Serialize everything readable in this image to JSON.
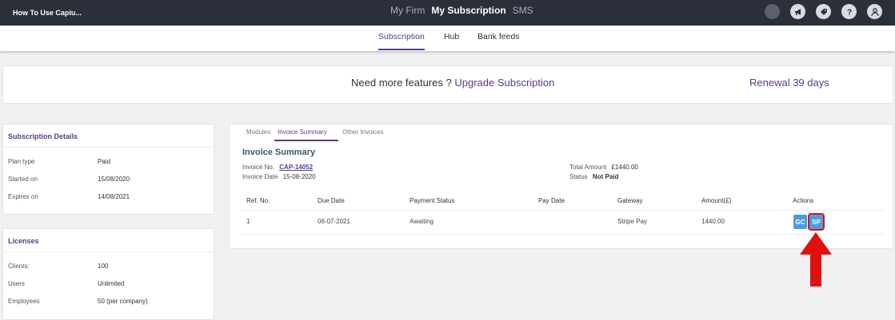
{
  "topbar": {
    "firm_name": "How To Use Capiu...",
    "nav": [
      {
        "label": "My Firm"
      },
      {
        "label": "My Subscription"
      },
      {
        "label": "SMS"
      }
    ]
  },
  "subnav": {
    "tabs": [
      {
        "label": "Subscription"
      },
      {
        "label": "Hub"
      },
      {
        "label": "Bank feeds"
      }
    ]
  },
  "banner": {
    "prompt": "Need more features ? ",
    "upgrade_link": "Upgrade Subscription",
    "renewal": "Renewal 39 days"
  },
  "subscription_details": {
    "title": "Subscription Details",
    "rows": [
      {
        "key": "Plan type",
        "value": "Paid"
      },
      {
        "key": "Started on",
        "value": "15/08/2020"
      },
      {
        "key": "Expires on",
        "value": "14/08/2021"
      }
    ]
  },
  "licenses": {
    "title": "Licenses",
    "rows": [
      {
        "key": "Clients:",
        "value": "100"
      },
      {
        "key": "Users",
        "value": "Unlimited"
      },
      {
        "key": "Employees",
        "value": "50 (per company)"
      }
    ]
  },
  "panel": {
    "tabs": [
      {
        "label": "Modules"
      },
      {
        "label": "Invoice Summary"
      },
      {
        "label": "Other Invoices"
      }
    ],
    "heading": "Invoice Summary",
    "invoice_no_label": "Invoice No.",
    "invoice_no": "CAP-14052",
    "invoice_date_label": "Invoice Date",
    "invoice_date": "15-08-2020",
    "total_label": "Total Amount",
    "total": "£1440.00",
    "status_label": "Status",
    "status": "Not Paid",
    "columns": [
      "Ref. No.",
      "Due Date",
      "Payment Status",
      "Pay Date",
      "Gateway",
      "Amount(£)",
      "Actions"
    ],
    "rows": [
      {
        "ref": "1",
        "due": "06-07-2021",
        "payment_status": "Awaiting",
        "pay_date": "",
        "gateway": "Stripe Pay",
        "amount": "1440.00"
      }
    ],
    "actions": {
      "gc": "GC",
      "sp": "SP"
    }
  },
  "colors": {
    "accent": "#5b3d8a",
    "topbar": "#2a2f3a",
    "action_button": "#4a9de0",
    "highlight": "#e01010"
  }
}
